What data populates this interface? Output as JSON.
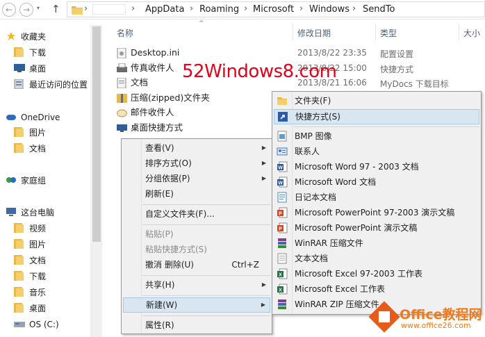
{
  "address_bar": {
    "crumbs": [
      "AppData",
      "Roaming",
      "Microsoft",
      "Windows",
      "SendTo"
    ],
    "nav_back": "←",
    "nav_forward": "→",
    "nav_recent": "▾",
    "nav_up": "↑",
    "separator": "›"
  },
  "nav_pane": {
    "items": [
      {
        "label": "收藏夹",
        "icon": "star-icon"
      },
      {
        "label": "下载",
        "icon": "folder-icon"
      },
      {
        "label": "桌面",
        "icon": "desktop-icon"
      },
      {
        "label": "最近访问的位置",
        "icon": "recent-places-icon"
      },
      {
        "label": "OneDrive",
        "icon": "cloud-icon"
      },
      {
        "label": "图片",
        "icon": "folder-icon"
      },
      {
        "label": "文档",
        "icon": "folder-icon"
      },
      {
        "label": "家庭组",
        "icon": "homegroup-icon"
      },
      {
        "label": "这台电脑",
        "icon": "computer-icon"
      },
      {
        "label": "视频",
        "icon": "folder-icon"
      },
      {
        "label": "图片",
        "icon": "folder-icon"
      },
      {
        "label": "文档",
        "icon": "folder-icon"
      },
      {
        "label": "下载",
        "icon": "folder-icon"
      },
      {
        "label": "音乐",
        "icon": "folder-icon"
      },
      {
        "label": "桌面",
        "icon": "folder-icon"
      },
      {
        "label": "OS (C:)",
        "icon": "drive-icon"
      }
    ]
  },
  "columns": {
    "name": "名称",
    "date": "修改日期",
    "type": "类型",
    "size": "大小",
    "sort_arrow": "^"
  },
  "files": [
    {
      "name": "Desktop.ini",
      "date": "2013/8/22 23:35",
      "type": "配置设置",
      "icon": "ini-file-icon"
    },
    {
      "name": "传真收件人",
      "date": "2013/8/22 15:00",
      "type": "快捷方式",
      "icon": "fax-icon"
    },
    {
      "name": "文档",
      "date": "2013/8/21 16:06",
      "type": "MyDocs 下载目标",
      "icon": "document-icon"
    },
    {
      "name": "压缩(zipped)文件夹",
      "date": "",
      "type": "",
      "icon": "zip-folder-icon"
    },
    {
      "name": "邮件收件人",
      "date": "",
      "type": "",
      "icon": "mail-icon"
    },
    {
      "name": "桌面快捷方式",
      "date": "",
      "type": "",
      "icon": "desktop-icon"
    }
  ],
  "watermark": "52Windows8.com",
  "context_menu": {
    "view": "查看(V)",
    "sort_by": "排序方式(O)",
    "group_by": "分组依据(P)",
    "refresh": "刷新(E)",
    "customize": "自定义文件夹(F)...",
    "paste": "粘贴(P)",
    "paste_shortcut": "粘贴快捷方式(S)",
    "undo_delete": "撤消 删除(U)",
    "undo_shortcut": "Ctrl+Z",
    "share": "共享(H)",
    "new": "新建(W)",
    "properties": "属性(R)",
    "submenu_arrow": "▶"
  },
  "submenu": {
    "items": [
      {
        "label": "文件夹(F)",
        "icon": "folder-icon",
        "color": "#e8b84a"
      },
      {
        "label": "快捷方式(S)",
        "icon": "shortcut-icon",
        "color": "#2a5aa8"
      },
      {
        "label": "BMP 图像",
        "icon": "bmp-icon",
        "color": "#5aa0d8"
      },
      {
        "label": "联系人",
        "icon": "contact-icon",
        "color": "#4a7ab8"
      },
      {
        "label": "Microsoft Word 97 - 2003 文档",
        "icon": "word-icon",
        "color": "#2b579a"
      },
      {
        "label": "Microsoft Word 文档",
        "icon": "word-icon",
        "color": "#2b579a"
      },
      {
        "label": "日记本文档",
        "icon": "journal-icon",
        "color": "#4a8ac8"
      },
      {
        "label": "Microsoft PowerPoint 97-2003 演示文稿",
        "icon": "powerpoint-icon",
        "color": "#d24726"
      },
      {
        "label": "Microsoft PowerPoint 演示文稿",
        "icon": "powerpoint-icon",
        "color": "#d24726"
      },
      {
        "label": "WinRAR 压缩文件",
        "icon": "winrar-icon",
        "color": "#8a3a8a"
      },
      {
        "label": "文本文档",
        "icon": "text-file-icon",
        "color": "#8a8a8a"
      },
      {
        "label": "Microsoft Excel 97-2003 工作表",
        "icon": "excel-icon",
        "color": "#217346"
      },
      {
        "label": "Microsoft Excel 工作表",
        "icon": "excel-icon",
        "color": "#217346"
      },
      {
        "label": "WinRAR ZIP 压缩文件",
        "icon": "winrar-zip-icon",
        "color": "#8a3a8a"
      }
    ]
  },
  "logo": {
    "name": "Office教程网",
    "url": "www.office26.com",
    "color": "#f07a1c"
  }
}
